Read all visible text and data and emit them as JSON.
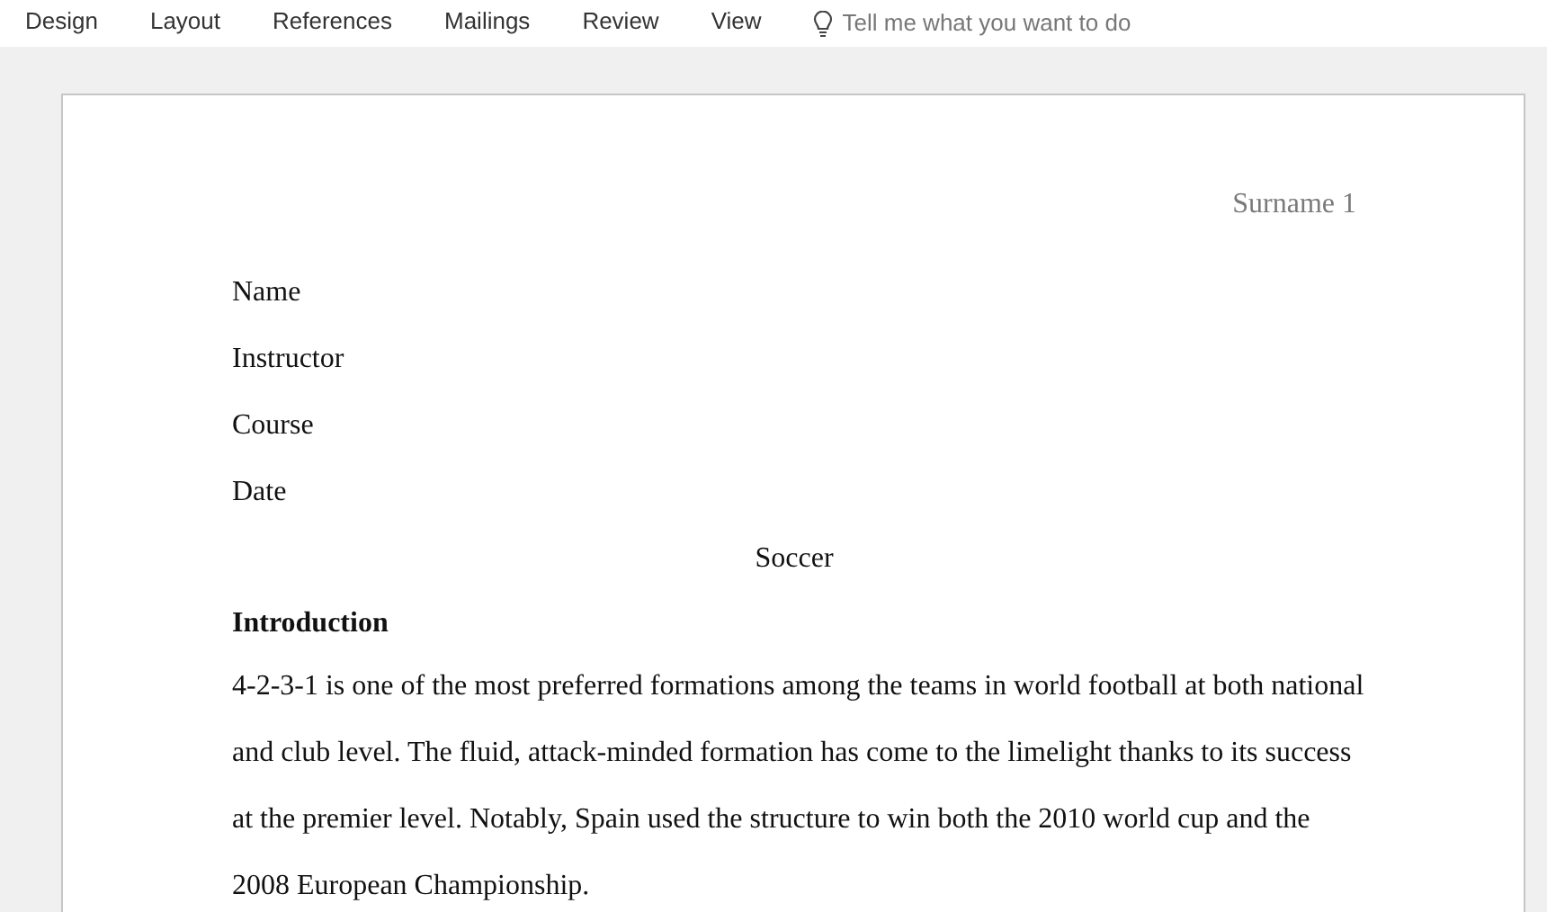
{
  "ribbon": {
    "tabs": [
      {
        "label": "Design",
        "selected": false
      },
      {
        "label": "Layout",
        "selected": false
      },
      {
        "label": "References",
        "selected": false
      },
      {
        "label": "Mailings",
        "selected": false
      },
      {
        "label": "Review",
        "selected": false
      },
      {
        "label": "View",
        "selected": false
      }
    ],
    "tell_me": {
      "placeholder": "Tell me what you want to do"
    }
  },
  "document": {
    "header": "Surname 1",
    "lines": [
      "Name",
      "Instructor",
      "Course",
      "Date"
    ],
    "title": "Soccer",
    "heading": "Introduction",
    "paragraph": "4-2-3-1 is one of the most preferred formations among the teams in world football at both national and club level. The fluid, attack-minded formation has come to the limelight thanks to its success at the premier level. Notably, Spain used the structure to win both the 2010 world cup and the 2008 European Championship."
  }
}
